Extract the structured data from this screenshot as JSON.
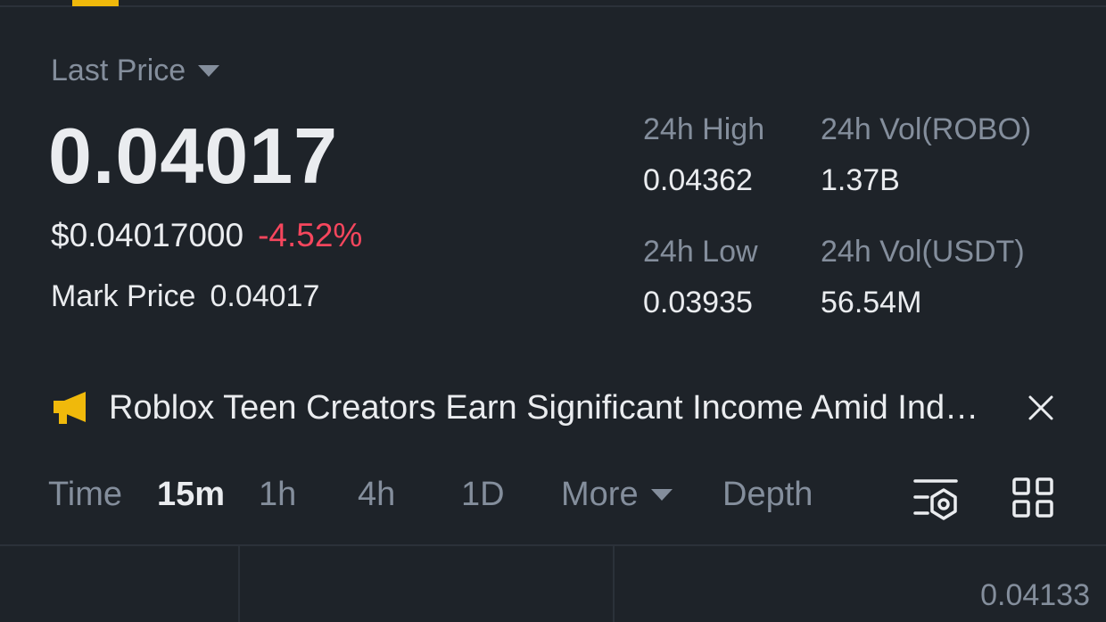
{
  "ticker": {
    "price_type_label": "Last Price",
    "last_price": "0.04017",
    "usd_price": "$0.04017000",
    "change_pct": "-4.52%",
    "mark_price_label": "Mark Price",
    "mark_price": "0.04017"
  },
  "stats": {
    "high_label": "24h High",
    "high_value": "0.04362",
    "vol_base_label": "24h Vol(ROBO)",
    "vol_base_value": "1.37B",
    "low_label": "24h Low",
    "low_value": "0.03935",
    "vol_quote_label": "24h Vol(USDT)",
    "vol_quote_value": "56.54M"
  },
  "news": {
    "headline": "Roblox Teen Creators Earn Significant Income Amid Industry Growth",
    "icon": "megaphone-icon"
  },
  "chart_tabs": {
    "time": "Time",
    "m15": "15m",
    "h1": "1h",
    "h4": "4h",
    "d1": "1D",
    "more": "More",
    "depth": "Depth",
    "active": "15m"
  },
  "chart": {
    "price_axis_label": "0.04133"
  },
  "colors": {
    "background": "#1e2329",
    "accent": "#f0b90b",
    "negative": "#f6465d",
    "muted": "#848e9c"
  }
}
